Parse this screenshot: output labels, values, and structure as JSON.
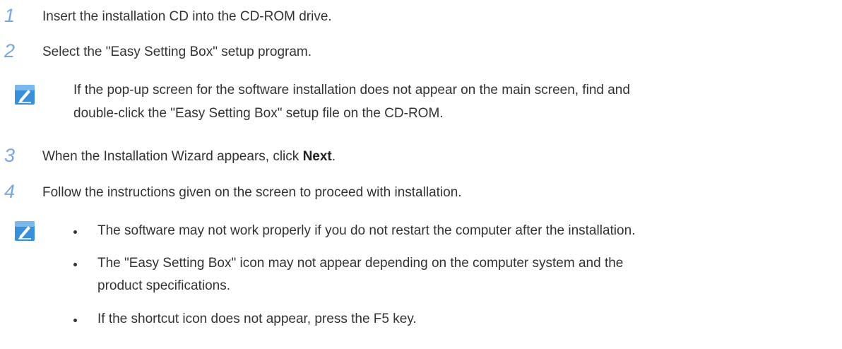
{
  "steps": [
    {
      "number": "1",
      "text": "Insert the installation CD into the CD-ROM drive."
    },
    {
      "number": "2",
      "text": "Select the \"Easy Setting Box\" setup program."
    },
    {
      "number": "3",
      "text_before": "When the Installation Wizard appears, click ",
      "text_bold": "Next",
      "text_after": "."
    },
    {
      "number": "4",
      "text": "Follow the instructions given on the screen to proceed with installation."
    }
  ],
  "note1": {
    "icon": "note-pencil-icon",
    "line1": "If the pop-up screen for the software installation does not appear on the main screen, find and",
    "line2": "double-click the \"Easy Setting Box\" setup file on the CD-ROM."
  },
  "note2": {
    "icon": "note-pencil-icon",
    "bullets": [
      {
        "lines": [
          "The software may not work properly if you do not restart the computer after the installation."
        ]
      },
      {
        "lines": [
          "The \"Easy Setting Box\" icon may not appear depending on the computer system and the",
          "product specifications."
        ]
      },
      {
        "lines": [
          "If the shortcut icon does not appear, press the F5 key."
        ]
      }
    ]
  },
  "colors": {
    "step_number": "#7aa6e0",
    "icon_bg": "#3a8fd9",
    "text": "#333333"
  }
}
